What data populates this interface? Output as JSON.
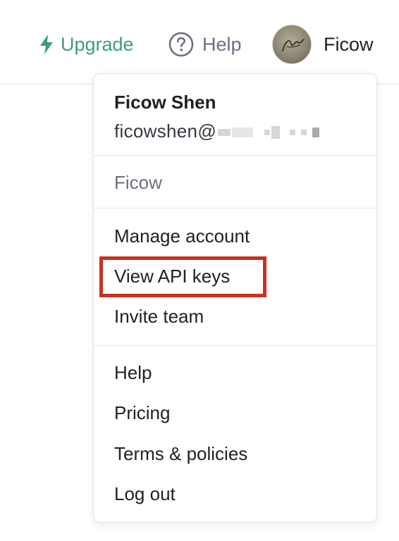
{
  "topbar": {
    "upgrade_label": "Upgrade",
    "help_label": "Help",
    "user_label": "Ficow"
  },
  "menu": {
    "user_name": "Ficow Shen",
    "user_email_prefix": "ficowshen@",
    "org_name": "Ficow",
    "items": [
      {
        "label": "Manage account"
      },
      {
        "label": "View API keys"
      },
      {
        "label": "Invite team"
      },
      {
        "label": "Help"
      },
      {
        "label": "Pricing"
      },
      {
        "label": "Terms & policies"
      },
      {
        "label": "Log out"
      }
    ],
    "highlighted_item": "View API keys"
  },
  "colors": {
    "accent_green": "#3f9c7b",
    "highlight_red": "#c8321f",
    "muted_gray": "#6e6e80"
  },
  "icons": {
    "upgrade": "lightning-bolt-icon",
    "help": "question-circle-icon",
    "avatar": "user-avatar"
  }
}
